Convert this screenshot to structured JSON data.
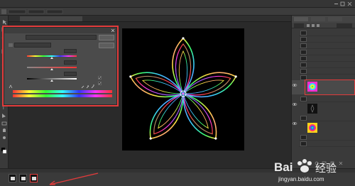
{
  "menubar": {
    "items": [
      "",
      "",
      "",
      "",
      "",
      "",
      "",
      "",
      "",
      "",
      ""
    ]
  },
  "optionsbar": {
    "items": [
      "",
      "",
      "",
      ""
    ]
  },
  "document": {
    "tab_title": ""
  },
  "dialog": {
    "title": "",
    "preset_label": "",
    "preset_value": "",
    "channel_value": "",
    "ok_label": "",
    "cancel_label": "",
    "hue": {
      "label": "",
      "value": "",
      "level": 0.5
    },
    "saturation": {
      "label": "",
      "value": "",
      "level": 0.5
    },
    "lightness": {
      "label": "",
      "value": "",
      "level": 0.5
    },
    "colorize_label": "",
    "preview_label": ""
  },
  "layers": [
    {
      "name": ""
    },
    {
      "name": ""
    },
    {
      "name": ""
    },
    {
      "name": ""
    },
    {
      "name": ""
    },
    {
      "name": ""
    },
    {
      "name": ""
    },
    {
      "name": ""
    },
    {
      "name": ""
    },
    {
      "name": ""
    },
    {
      "name": ""
    },
    {
      "name": ""
    },
    {
      "name": ""
    },
    {
      "name": ""
    },
    {
      "name": ""
    }
  ],
  "status": {
    "zoom": ""
  },
  "bottom_panel": {
    "title": "",
    "frames": [
      "",
      "",
      ""
    ]
  },
  "watermark": {
    "brand": "Bai",
    "brand_suffix": "经验",
    "url": "jingyan.baidu.com"
  },
  "colors": {
    "highlight": "#e23b3b",
    "panel": "#3a3a3a",
    "canvas": "#000000"
  }
}
